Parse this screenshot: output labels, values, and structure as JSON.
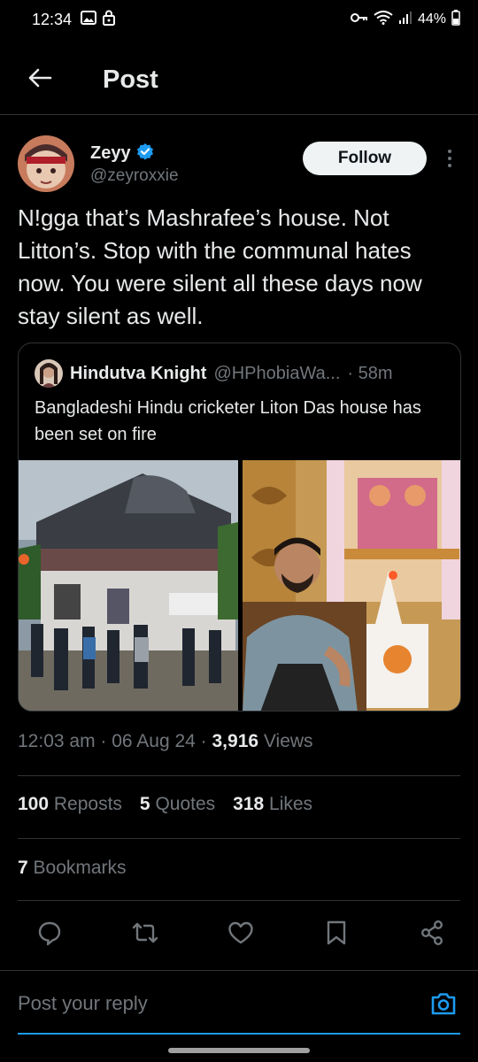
{
  "status_bar": {
    "time": "12:34",
    "battery": "44%",
    "icons": [
      "gallery-icon",
      "lock-icon",
      "key-icon",
      "wifi-icon",
      "signal-icon",
      "battery-icon"
    ]
  },
  "header": {
    "title": "Post"
  },
  "post": {
    "author": {
      "display_name": "Zeyy",
      "username": "@zeyroxxie",
      "verified": true
    },
    "follow_label": "Follow",
    "text": "N!gga that’s Mashrafee’s house. Not Litton’s. Stop with the communal hates now. You were silent all these days now stay silent as well.",
    "quoted": {
      "display_name": "Hindutva Knight",
      "username": "@HPhobiaWa...",
      "time": "· 58m",
      "text": "Bangladeshi Hindu cricketer Liton Das house has been set on fire"
    },
    "meta": {
      "time": "12:03 am",
      "sep1": " · ",
      "date": "06 Aug 24",
      "sep2": " · ",
      "views_count": "3,916",
      "views_label": " Views"
    },
    "stats": {
      "reposts_count": "100",
      "reposts_label": " Reposts",
      "quotes_count": "5",
      "quotes_label": " Quotes",
      "likes_count": "318",
      "likes_label": " Likes",
      "bookmarks_count": "7",
      "bookmarks_label": " Bookmarks"
    }
  },
  "reply": {
    "placeholder": "Post your reply"
  },
  "colors": {
    "background": "#000000",
    "accent": "#1d9bf0",
    "muted": "#71767b",
    "divider": "#2f3336"
  }
}
